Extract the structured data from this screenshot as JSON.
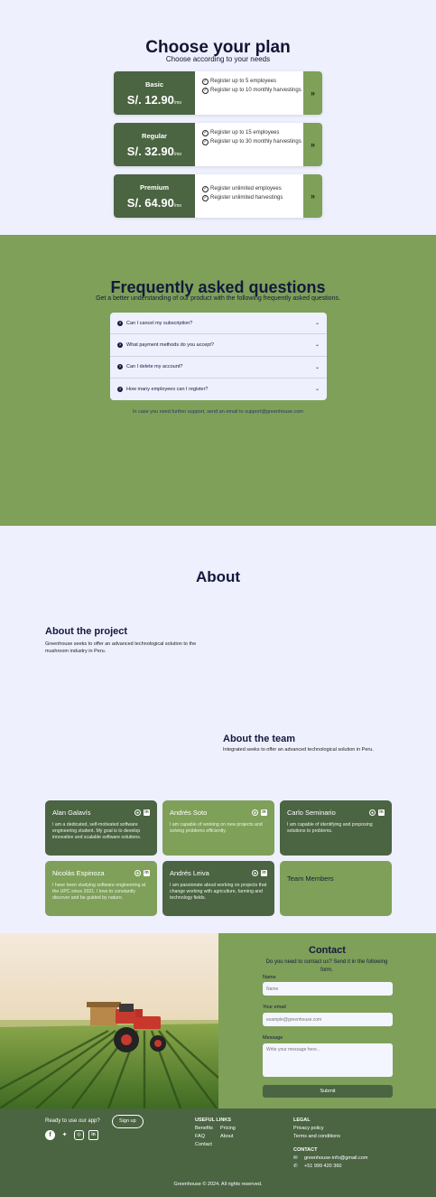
{
  "plans": {
    "title": "Choose your plan",
    "subtitle": "Choose according to your needs",
    "items": [
      {
        "name": "Basic",
        "price": "S/. 12.90",
        "period": "/mo",
        "features": [
          "Register up to 5 employees",
          "Register up to 10 monthly harvestings"
        ]
      },
      {
        "name": "Regular",
        "price": "S/. 32.90",
        "period": "/mo",
        "features": [
          "Register up to 15 employees",
          "Register up to 30 monthly harvestings"
        ]
      },
      {
        "name": "Premium",
        "price": "S/. 64.90",
        "period": "/mo",
        "features": [
          "Register unlimited employees",
          "Register unlimited harvestings"
        ]
      }
    ],
    "arrow": "»"
  },
  "faq": {
    "title": "Frequently asked questions",
    "subtitle": "Get a better understanding of our product with the following frequently asked questions.",
    "questions": [
      "Can I cancel my subscription?",
      "What payment methods do you accept?",
      "Can I delete my account?",
      "How many employees can I register?"
    ],
    "note": "In case you need further support, send an email to support@greenhouse.com"
  },
  "about": {
    "title": "About",
    "project_heading": "About the project",
    "project_text": "Greenhouse seeks to offer an advanced technological solution to the mushroom industry in Peru.",
    "team_heading": "About the team",
    "team_text": "Integrated seeks to offer an advanced technological solution in Peru.",
    "members": [
      {
        "name": "Alan Galavís",
        "desc": "I am a dedicated, self-motivated software engineering student. My goal is to develop innovative and scalable software solutions."
      },
      {
        "name": "Andrés Soto",
        "desc": "I am capable of working on new projects and solving problems efficiently."
      },
      {
        "name": "Carlo Seminario",
        "desc": "I am capable of identifying and proposing solutions to problems."
      },
      {
        "name": "Nicolás Espinoza",
        "desc": "I have been studying software engineering at the UPC since 2021. I love to constantly discover and be guided by nature."
      },
      {
        "name": "Andrés Leiva",
        "desc": "I am passionate about working on projects that change working with agriculture, farming and technology fields."
      }
    ],
    "team_label": "Team Members"
  },
  "contact": {
    "title": "Contact",
    "subtitle": "Do you need to contact us? Send it in the following form.",
    "name_label": "Name",
    "name_placeholder": "Name",
    "email_label": "Your email",
    "email_placeholder": "example@greenhouse.com",
    "message_label": "Message",
    "message_placeholder": "Write your message here...",
    "submit_label": "Submit"
  },
  "footer": {
    "ready_text": "Ready to use our app?",
    "signup_label": "Sign up",
    "useful_heading": "USEFUL LINKS",
    "useful_links": [
      "Benefits",
      "Pricing",
      "FAQ",
      "About",
      "Contact"
    ],
    "legal_heading": "LEGAL",
    "legal_links": [
      "Privacy policy",
      "Terms and conditions"
    ],
    "contact_heading": "CONTACT",
    "contact_email": "greenhouse-info@gmail.com",
    "contact_phone": "+51 999 420 360",
    "copyright": "Greenhouse © 2024. All rights reserved."
  },
  "colors": {
    "dark_green": "#4b6442",
    "light_green": "#7ea059",
    "lavender_bg": "#eef0fd",
    "navy_text": "#14193d"
  },
  "icons": [
    "check-circle-icon",
    "double-chevron-right-icon",
    "question-circle-icon",
    "chevron-down-icon",
    "github-icon",
    "linkedin-icon",
    "facebook-icon",
    "twitter-icon",
    "instagram-icon",
    "envelope-icon",
    "phone-icon"
  ]
}
